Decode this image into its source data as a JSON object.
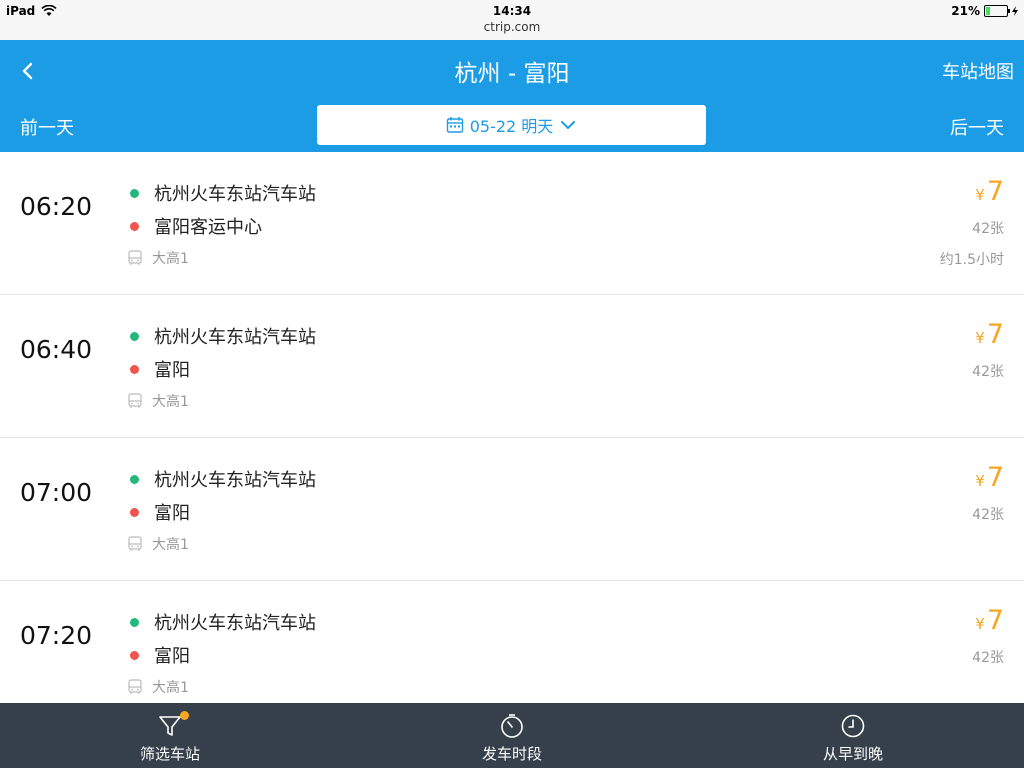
{
  "status_bar": {
    "device": "iPad",
    "time": "14:34",
    "url": "ctrip.com",
    "battery": "21%",
    "battery_level": 0.21
  },
  "header": {
    "title": "杭州 - 富阳",
    "map_label": "车站地图",
    "prev_label": "前一天",
    "next_label": "后一天",
    "date_label": "05-22 明天"
  },
  "trips": [
    {
      "time": "06:20",
      "from": "杭州火车东站汽车站",
      "to": "富阳客运中心",
      "bus": "大高1",
      "currency": "¥",
      "price": "7",
      "tickets": "42张",
      "duration": "约1.5小时"
    },
    {
      "time": "06:40",
      "from": "杭州火车东站汽车站",
      "to": "富阳",
      "bus": "大高1",
      "currency": "¥",
      "price": "7",
      "tickets": "42张",
      "duration": ""
    },
    {
      "time": "07:00",
      "from": "杭州火车东站汽车站",
      "to": "富阳",
      "bus": "大高1",
      "currency": "¥",
      "price": "7",
      "tickets": "42张",
      "duration": ""
    },
    {
      "time": "07:20",
      "from": "杭州火车东站汽车站",
      "to": "富阳",
      "bus": "大高1",
      "currency": "¥",
      "price": "7",
      "tickets": "42张",
      "duration": ""
    }
  ],
  "bottom_bar": {
    "filter_label": "筛选车站",
    "period_label": "发车时段",
    "sort_label": "从早到晚"
  },
  "colors": {
    "header": "#1d9ce6",
    "price": "#f5a623",
    "origin_dot": "#25b87e",
    "dest_dot": "#f0544f",
    "bottom_bar": "#283440"
  },
  "icons": {
    "back": "chevron-left-icon",
    "calendar": "calendar-icon",
    "dropdown": "chevron-down-icon",
    "bus": "bus-icon",
    "filter": "funnel-icon",
    "period": "timer-icon",
    "sort": "clock-icon"
  }
}
